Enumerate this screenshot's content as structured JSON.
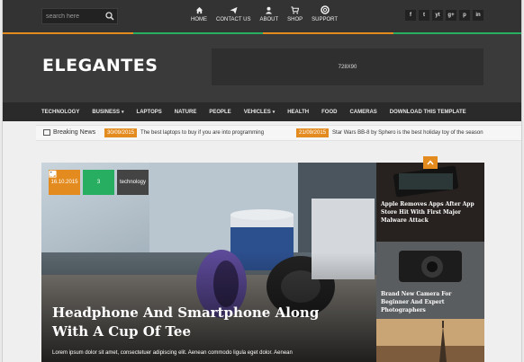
{
  "colors": {
    "accent": "#e48b1f",
    "green": "#27ae60",
    "dark": "#333333"
  },
  "search": {
    "placeholder": "search here"
  },
  "top_nav": [
    {
      "label": "HOME",
      "icon": "home-icon"
    },
    {
      "label": "CONTACT US",
      "icon": "paper-plane-icon"
    },
    {
      "label": "ABOUT",
      "icon": "user-icon"
    },
    {
      "label": "SHOP",
      "icon": "cart-icon"
    },
    {
      "label": "SUPPORT",
      "icon": "lifebuoy-icon"
    }
  ],
  "social": [
    "f",
    "t",
    "yt",
    "g+",
    "p",
    "in"
  ],
  "brand": {
    "logo": "ELEGANTES",
    "ad_label": "728X90"
  },
  "main_nav": [
    {
      "label": "TECHNOLOGY",
      "dropdown": false
    },
    {
      "label": "BUSINESS",
      "dropdown": true
    },
    {
      "label": "LAPTOPS",
      "dropdown": false
    },
    {
      "label": "NATURE",
      "dropdown": false
    },
    {
      "label": "PEOPLE",
      "dropdown": false
    },
    {
      "label": "VEHICLES",
      "dropdown": true
    },
    {
      "label": "HEALTH",
      "dropdown": false
    },
    {
      "label": "FOOD",
      "dropdown": false
    },
    {
      "label": "CAMERAS",
      "dropdown": false
    },
    {
      "label": "DOWNLOAD THIS TEMPLATE",
      "dropdown": false
    }
  ],
  "breaking": {
    "label": "Breaking News",
    "items": [
      {
        "date": "30/09/2015",
        "text": "The best laptops to buy if you are into programming"
      },
      {
        "date": "21/09/2015",
        "text": "Star Wars BB-8 by Sphero is the best holiday toy of the season"
      }
    ]
  },
  "featured": {
    "date": "16.10.2015",
    "comments": "3",
    "tag": "technology",
    "title": "Headphone And Smartphone Along With A Cup Of Tee",
    "excerpt": "Lorem ipsum dolor sit amet, consectetuer adipiscing elit. Aenean commodo ligula eget dolor. Aenean"
  },
  "side_posts": [
    {
      "title": "Apple Removes Apps After App Store Hit With First Major Malware Attack"
    },
    {
      "title": "Brand New Camera For Beginner And Expert Photographers"
    }
  ]
}
